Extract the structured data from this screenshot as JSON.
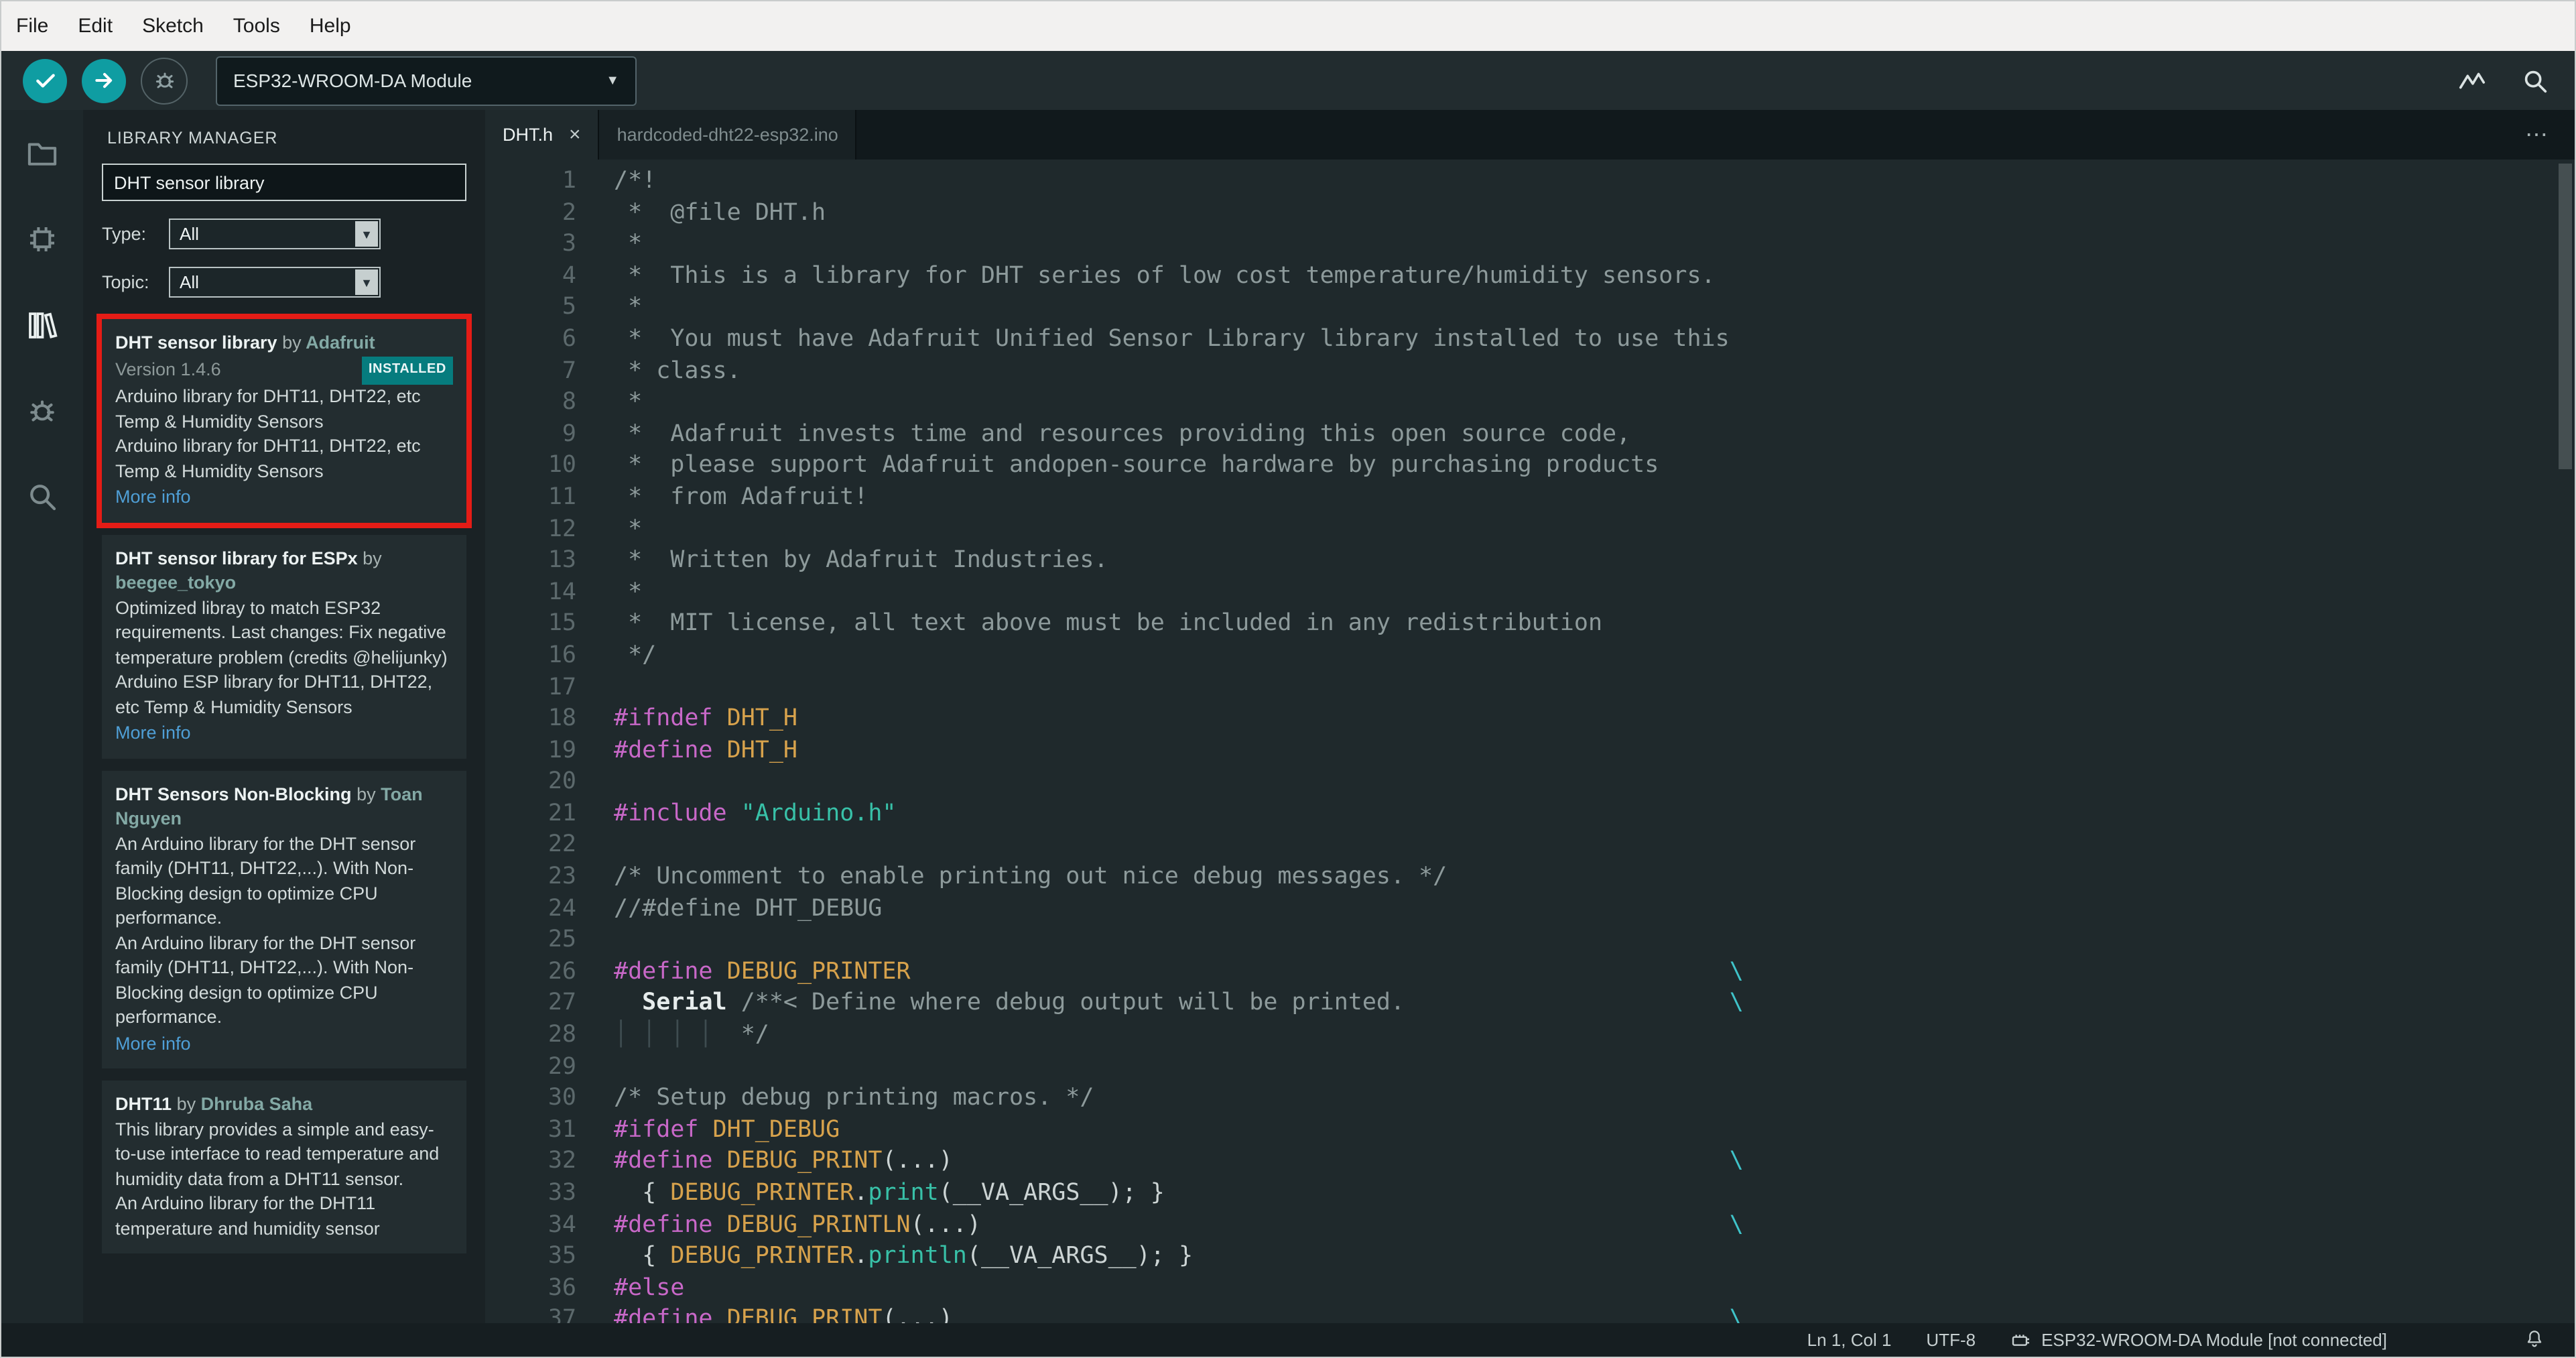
{
  "menu": {
    "items": [
      "File",
      "Edit",
      "Sketch",
      "Tools",
      "Help"
    ]
  },
  "toolbar": {
    "buttons": [
      {
        "name": "verify",
        "icon": "check",
        "style": "filled"
      },
      {
        "name": "upload",
        "icon": "arrow-right",
        "style": "filled"
      },
      {
        "name": "start-debugging",
        "icon": "bug",
        "style": "outline"
      }
    ],
    "board_selector": "ESP32-WROOM-DA Module",
    "right_icons": [
      {
        "name": "serial-plotter",
        "icon": "plotter"
      },
      {
        "name": "serial-monitor",
        "icon": "magnifier"
      }
    ]
  },
  "activity_bar": {
    "items": [
      {
        "name": "sketchbook",
        "icon": "folder",
        "active": false
      },
      {
        "name": "boards-manager",
        "icon": "chip",
        "active": false
      },
      {
        "name": "library-manager",
        "icon": "books",
        "active": true
      },
      {
        "name": "debugger",
        "icon": "bug",
        "active": false
      },
      {
        "name": "search",
        "icon": "magnifier",
        "active": false
      }
    ]
  },
  "library_manager": {
    "title": "LIBRARY MANAGER",
    "search_value": "DHT sensor library",
    "filters": [
      {
        "label": "Type:",
        "value": "All"
      },
      {
        "label": "Topic:",
        "value": "All"
      }
    ],
    "items": [
      {
        "name": "DHT sensor library",
        "by": "by",
        "author": "Adafruit",
        "version": "Version 1.4.6",
        "badge": "INSTALLED",
        "paragraphs": [
          "Arduino library for DHT11, DHT22, etc Temp & Humidity Sensors",
          "Arduino library for DHT11, DHT22, etc Temp & Humidity Sensors"
        ],
        "more_info": "More info",
        "highlighted": true
      },
      {
        "name": "DHT sensor library for ESPx",
        "by": "by",
        "author": "beegee_tokyo",
        "paragraphs": [
          "Optimized libray to match ESP32 requirements. Last changes: Fix negative temperature problem (credits @helijunky)",
          "Arduino ESP library for DHT11, DHT22, etc Temp & Humidity Sensors"
        ],
        "more_info": "More info"
      },
      {
        "name": "DHT Sensors Non-Blocking",
        "by": "by",
        "author": "Toan Nguyen",
        "paragraphs": [
          "An Arduino library for the DHT sensor family (DHT11, DHT22,...). With Non-Blocking design to optimize CPU performance.",
          "An Arduino library for the DHT sensor family (DHT11, DHT22,...). With Non-Blocking design to optimize CPU performance."
        ],
        "more_info": "More info"
      },
      {
        "name": "DHT11",
        "by": "by",
        "author": "Dhruba Saha",
        "paragraphs": [
          "This library provides a simple and easy-to-use interface to read temperature and humidity data from a DHT11 sensor.",
          "An Arduino library for the DHT11 temperature and humidity sensor"
        ]
      }
    ]
  },
  "editor": {
    "tabs": [
      {
        "label": "DHT.h",
        "active": true,
        "close": "×"
      },
      {
        "label": "hardcoded-dht22-esp32.ino",
        "active": false
      }
    ],
    "more_actions": "⋯",
    "code": {
      "lines": [
        {
          "n": 1,
          "t": [
            [
              "cm",
              "/*!"
            ]
          ]
        },
        {
          "n": 2,
          "t": [
            [
              "cm",
              " *  @file DHT.h"
            ]
          ]
        },
        {
          "n": 3,
          "t": [
            [
              "cm",
              " *"
            ]
          ]
        },
        {
          "n": 4,
          "t": [
            [
              "cm",
              " *  This is a library for DHT series of low cost temperature/humidity sensors."
            ]
          ]
        },
        {
          "n": 5,
          "t": [
            [
              "cm",
              " *"
            ]
          ]
        },
        {
          "n": 6,
          "t": [
            [
              "cm",
              " *  You must have Adafruit Unified Sensor Library library installed to use this"
            ]
          ]
        },
        {
          "n": 7,
          "t": [
            [
              "cm",
              " * class."
            ]
          ]
        },
        {
          "n": 8,
          "t": [
            [
              "cm",
              " *"
            ]
          ]
        },
        {
          "n": 9,
          "t": [
            [
              "cm",
              " *  Adafruit invests time and resources providing this open source code,"
            ]
          ]
        },
        {
          "n": 10,
          "t": [
            [
              "cm",
              " *  please support Adafruit andopen-source hardware by purchasing products"
            ]
          ]
        },
        {
          "n": 11,
          "t": [
            [
              "cm",
              " *  from Adafruit!"
            ]
          ]
        },
        {
          "n": 12,
          "t": [
            [
              "cm",
              " *"
            ]
          ]
        },
        {
          "n": 13,
          "t": [
            [
              "cm",
              " *  Written by Adafruit Industries."
            ]
          ]
        },
        {
          "n": 14,
          "t": [
            [
              "cm",
              " *"
            ]
          ]
        },
        {
          "n": 15,
          "t": [
            [
              "cm",
              " *  MIT license, all text above must be included in any redistribution"
            ]
          ]
        },
        {
          "n": 16,
          "t": [
            [
              "cm",
              " */"
            ]
          ]
        },
        {
          "n": 17,
          "t": []
        },
        {
          "n": 18,
          "t": [
            [
              "pp",
              "#ifndef"
            ],
            [
              "d",
              " "
            ],
            [
              "mac",
              "DHT_H"
            ]
          ]
        },
        {
          "n": 19,
          "t": [
            [
              "pp",
              "#define"
            ],
            [
              "d",
              " "
            ],
            [
              "mac",
              "DHT_H"
            ]
          ]
        },
        {
          "n": 20,
          "t": []
        },
        {
          "n": 21,
          "t": [
            [
              "pp",
              "#include"
            ],
            [
              "d",
              " "
            ],
            [
              "str",
              "\"Arduino.h\""
            ]
          ]
        },
        {
          "n": 22,
          "t": []
        },
        {
          "n": 23,
          "t": [
            [
              "cm",
              "/* Uncomment to enable printing out nice debug messages. */"
            ]
          ]
        },
        {
          "n": 24,
          "t": [
            [
              "cm",
              "//#define DHT_DEBUG"
            ]
          ]
        },
        {
          "n": 25,
          "t": []
        },
        {
          "n": 26,
          "t": [
            [
              "pp",
              "#define"
            ],
            [
              "d",
              " "
            ],
            [
              "mac",
              "DEBUG_PRINTER"
            ],
            [
              "d",
              "                                                          "
            ],
            [
              "esc",
              "\\"
            ]
          ]
        },
        {
          "n": 27,
          "t": [
            [
              "d",
              "  "
            ],
            [
              "cls",
              "Serial"
            ],
            [
              "d",
              " "
            ],
            [
              "cm",
              "/**< Define where debug output will be printed."
            ],
            [
              "d",
              "                       "
            ],
            [
              "esc",
              "\\"
            ]
          ]
        },
        {
          "n": 28,
          "t": [
            [
              "gd",
              "│ │ │ │ "
            ],
            [
              "d",
              " "
            ],
            [
              "cm",
              "*/"
            ]
          ]
        },
        {
          "n": 29,
          "t": []
        },
        {
          "n": 30,
          "t": [
            [
              "cm",
              "/* Setup debug printing macros. */"
            ]
          ]
        },
        {
          "n": 31,
          "t": [
            [
              "pp",
              "#ifdef"
            ],
            [
              "d",
              " "
            ],
            [
              "mac",
              "DHT_DEBUG"
            ]
          ]
        },
        {
          "n": 32,
          "t": [
            [
              "pp",
              "#define"
            ],
            [
              "d",
              " "
            ],
            [
              "mac",
              "DEBUG_PRINT"
            ],
            [
              "d",
              "(...)"
            ],
            [
              "d",
              "                                                       "
            ],
            [
              "esc",
              "\\"
            ]
          ]
        },
        {
          "n": 33,
          "t": [
            [
              "d",
              "  { "
            ],
            [
              "mac",
              "DEBUG_PRINTER"
            ],
            [
              "d",
              "."
            ],
            [
              "fn",
              "print"
            ],
            [
              "d",
              "(__VA_ARGS__); }"
            ]
          ]
        },
        {
          "n": 34,
          "t": [
            [
              "pp",
              "#define"
            ],
            [
              "d",
              " "
            ],
            [
              "mac",
              "DEBUG_PRINTLN"
            ],
            [
              "d",
              "(...)"
            ],
            [
              "d",
              "                                                     "
            ],
            [
              "esc",
              "\\"
            ]
          ]
        },
        {
          "n": 35,
          "t": [
            [
              "d",
              "  { "
            ],
            [
              "mac",
              "DEBUG_PRINTER"
            ],
            [
              "d",
              "."
            ],
            [
              "fn",
              "println"
            ],
            [
              "d",
              "(__VA_ARGS__); }"
            ]
          ]
        },
        {
          "n": 36,
          "t": [
            [
              "pp",
              "#else"
            ]
          ]
        },
        {
          "n": 37,
          "t": [
            [
              "pp",
              "#define"
            ],
            [
              "d",
              " "
            ],
            [
              "mac",
              "DEBUG_PRINT"
            ],
            [
              "d",
              "(...)"
            ],
            [
              "d",
              "                                                       "
            ],
            [
              "esc",
              "\\"
            ]
          ]
        }
      ]
    }
  },
  "status_bar": {
    "position": "Ln 1, Col 1",
    "encoding": "UTF-8",
    "board_status": "ESP32-WROOM-DA Module [not connected]",
    "icons": [
      "board-icon",
      "bell-icon"
    ]
  }
}
